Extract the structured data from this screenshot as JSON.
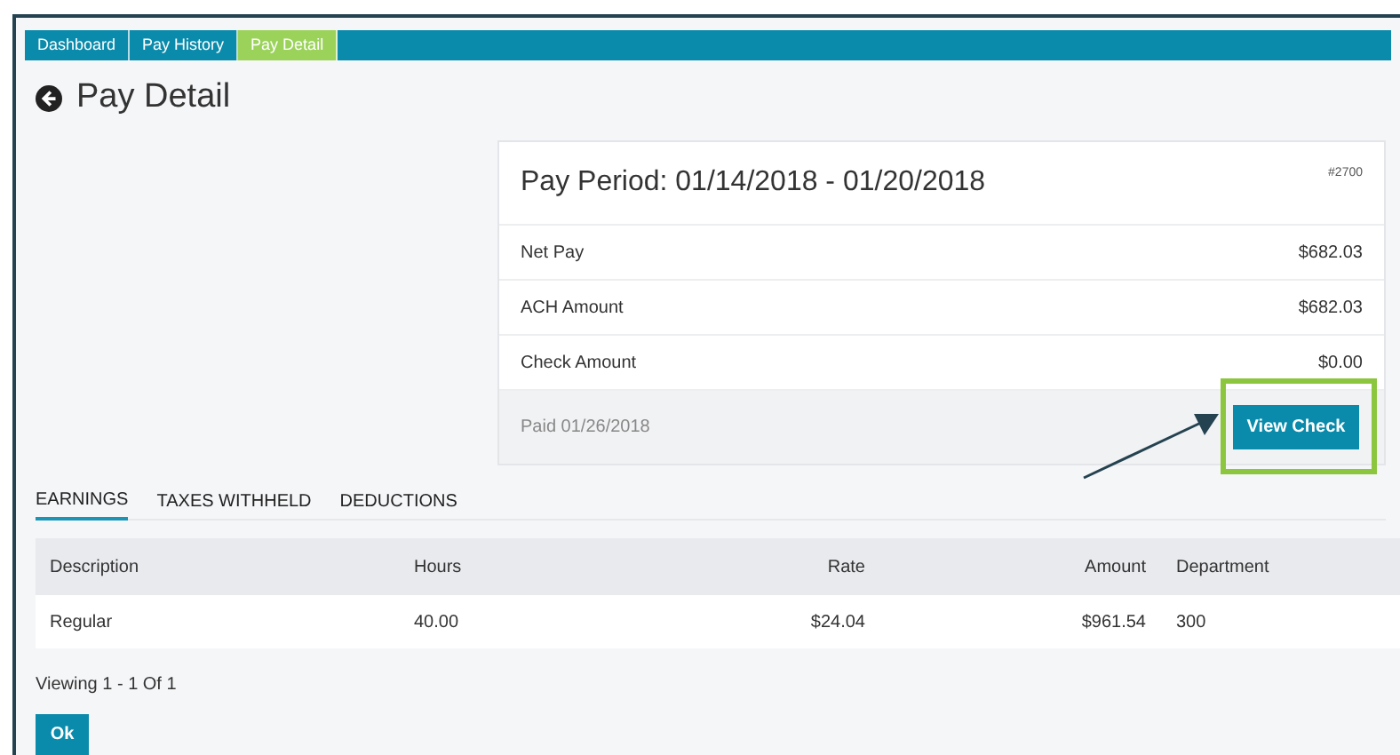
{
  "breadcrumbs": [
    {
      "label": "Dashboard",
      "selected": false
    },
    {
      "label": "Pay History",
      "selected": false
    },
    {
      "label": "Pay Detail",
      "selected": true
    }
  ],
  "title": "Pay Detail",
  "pay_card": {
    "period": "Pay Period: 01/14/2018 - 01/20/2018",
    "number": "#2700",
    "rows": [
      {
        "label": "Net Pay",
        "value": "$682.03"
      },
      {
        "label": "ACH Amount",
        "value": "$682.03"
      },
      {
        "label": "Check Amount",
        "value": "$0.00"
      }
    ],
    "paid": "Paid 01/26/2018",
    "button": "View Check",
    "highlighted": true
  },
  "tabs": [
    {
      "label": "EARNINGS",
      "selected": true
    },
    {
      "label": "TAXES WITHHELD",
      "selected": false
    },
    {
      "label": "DEDUCTIONS",
      "selected": false
    }
  ],
  "table": {
    "columns": [
      "Description",
      "Hours",
      "Rate",
      "Amount",
      "Department"
    ],
    "rows": [
      [
        "Regular",
        "40.00",
        "$24.04",
        "$961.54",
        "300"
      ]
    ]
  },
  "footer": "Viewing 1 - 1 Of 1",
  "ok_button": "Ok"
}
